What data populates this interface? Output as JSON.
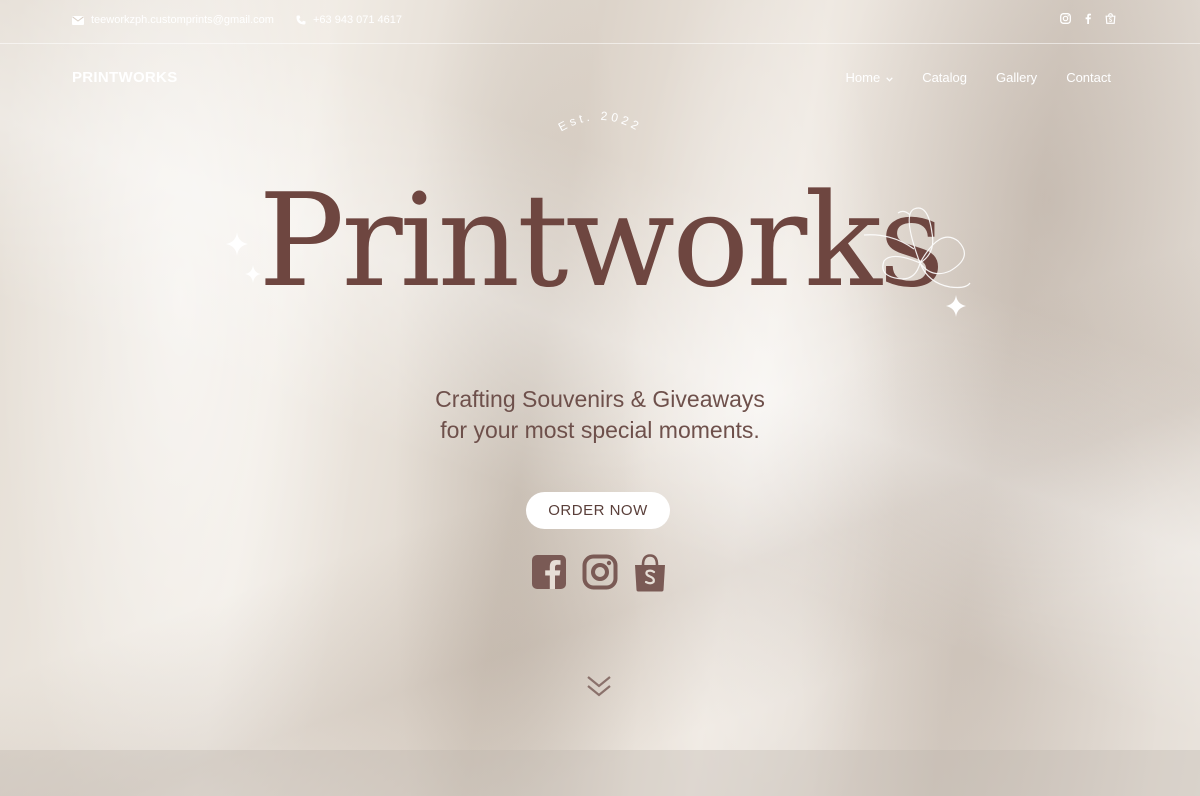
{
  "topbar": {
    "email": "teeworkzph.customprints@gmail.com",
    "phone": "+63 943 071 4617",
    "social_icons": [
      "instagram-icon",
      "facebook-icon",
      "shop-icon"
    ]
  },
  "nav": {
    "brand": "PRINTWORKS",
    "links": [
      {
        "label": "Home",
        "has_dropdown": true
      },
      {
        "label": "Catalog"
      },
      {
        "label": "Gallery"
      },
      {
        "label": "Contact"
      }
    ]
  },
  "hero": {
    "est": "Est. 2022",
    "title": "Printworks",
    "tagline_line1": "Crafting Souvenirs & Giveaways",
    "tagline_line2": "for your most special moments.",
    "cta": "ORDER NOW",
    "social_icons": [
      "facebook-icon",
      "instagram-icon",
      "shopee-icon"
    ],
    "scroll_icon": "chevron-double-down-icon"
  },
  "colors": {
    "title": "#6e4640",
    "text_brown": "#6e504b",
    "white": "#ffffff"
  }
}
